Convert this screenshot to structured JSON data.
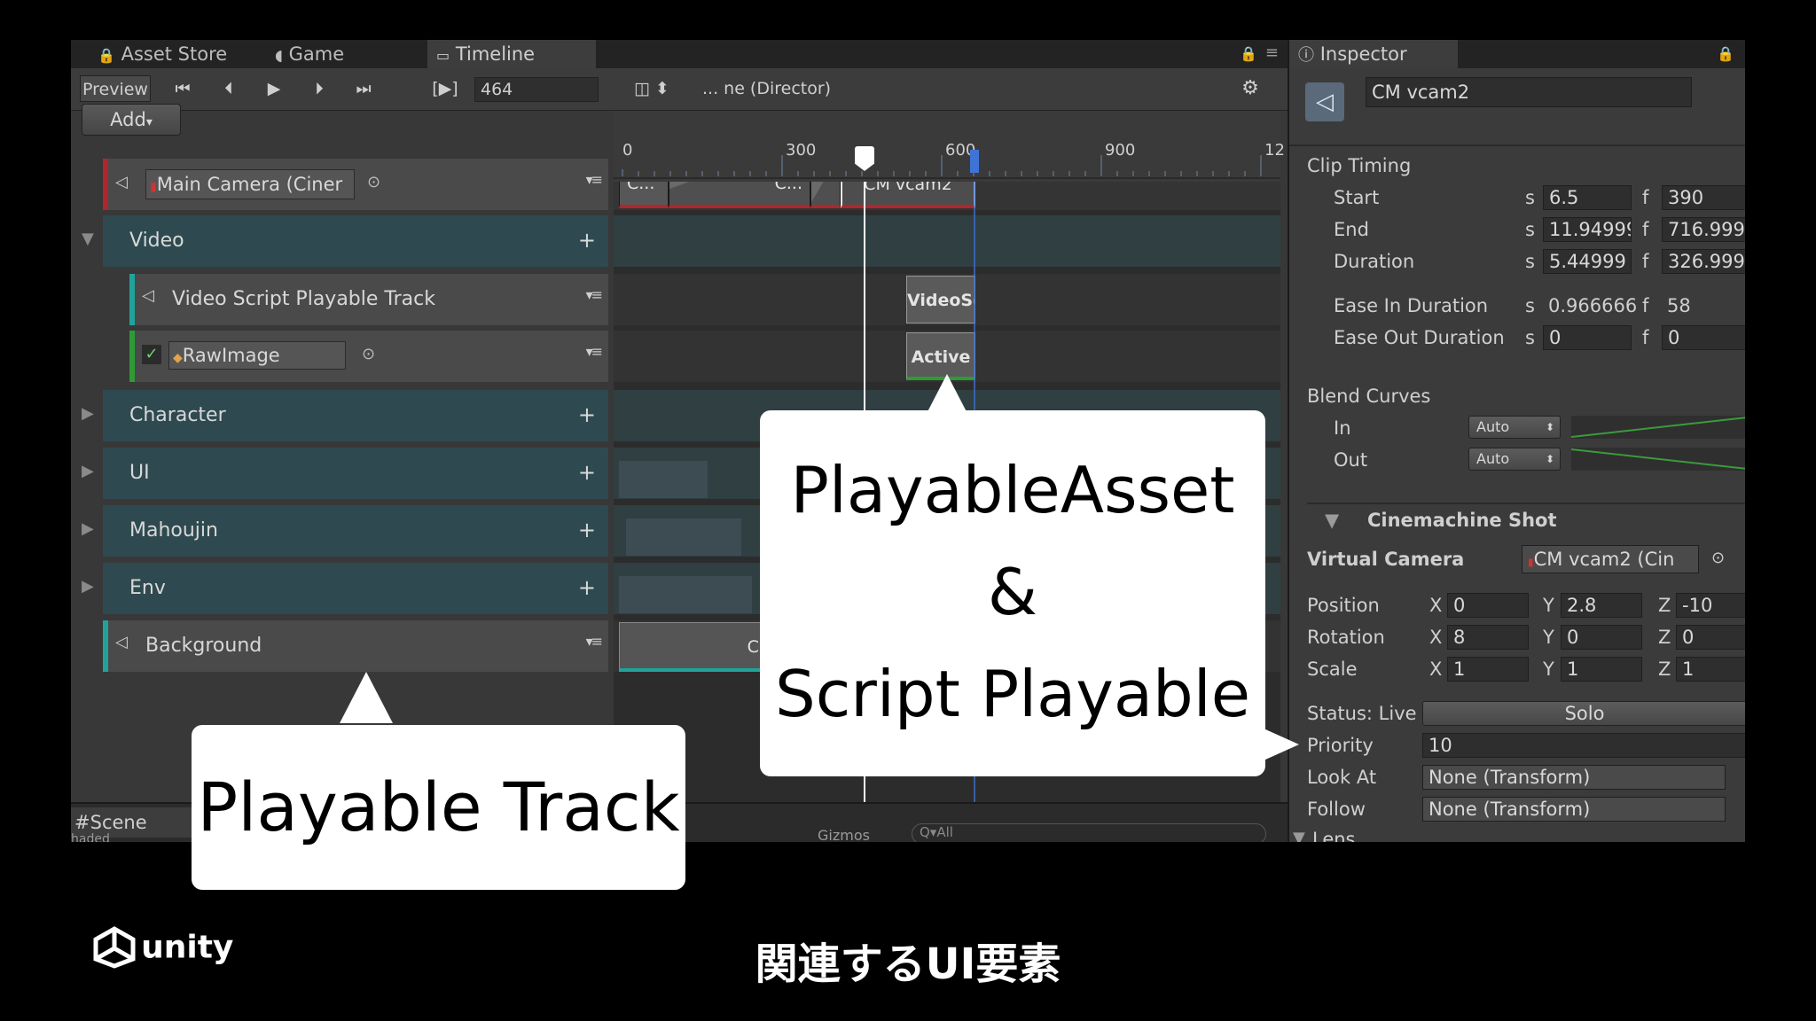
{
  "tabs": {
    "asset_store": "Asset Store",
    "game": "Game",
    "timeline": "Timeline",
    "inspector": "Inspector",
    "scene": "Scene"
  },
  "timeline_toolbar": {
    "preview": "Preview",
    "frame": "464",
    "director": "... ne (Director)",
    "frame_toggle": "[▶]",
    "add": "Add"
  },
  "ruler": {
    "labels": [
      "0",
      "300",
      "600",
      "900",
      "12"
    ]
  },
  "tracks": {
    "main_camera": "Main Camera (Ciner",
    "video": "Video",
    "video_script": "Video Script Playable Track",
    "rawimage": "RawImage",
    "character": "Character",
    "ui": "UI",
    "mahoujin": "Mahoujin",
    "env": "Env",
    "background": "Background"
  },
  "clips": {
    "c1": "C...",
    "c2": "C...",
    "cm_vcam2": "CM vcam2",
    "videosc": "VideoSc...",
    "active": "Active",
    "cont": "Cont"
  },
  "inspector": {
    "object_name": "CM vcam2",
    "clip_timing": "Clip Timing",
    "start_label": "Start",
    "start_s": "6.5",
    "start_f": "390",
    "end_label": "End",
    "end_s": "11.94999",
    "end_f": "716.999",
    "duration_label": "Duration",
    "duration_s": "5.44999",
    "duration_f": "326.999",
    "ease_in_label": "Ease In Duration",
    "ease_in_s": "0.966666",
    "ease_in_f": "58",
    "ease_out_label": "Ease Out Duration",
    "ease_out_s": "0",
    "ease_out_f": "0",
    "s": "s",
    "f": "f",
    "blend_curves": "Blend Curves",
    "in_label": "In",
    "in_value": "Auto",
    "out_label": "Out",
    "out_value": "Auto",
    "cinemachine_shot": "Cinemachine Shot",
    "virtual_camera_label": "Virtual Camera",
    "virtual_camera_value": "CM vcam2 (Cin",
    "position_label": "Position",
    "pos_x": "0",
    "pos_y": "2.8",
    "pos_z": "-10",
    "rotation_label": "Rotation",
    "rot_x": "8",
    "rot_y": "0",
    "rot_z": "0",
    "scale_label": "Scale",
    "scale_x": "1",
    "scale_y": "1",
    "scale_z": "1",
    "x": "X",
    "y": "Y",
    "z": "Z",
    "status_label": "Status: Live",
    "solo": "Solo",
    "priority_label": "Priority",
    "priority_value": "10",
    "look_at_label": "Look At",
    "look_at_value": "None (Transform)",
    "follow_label": "Follow",
    "follow_value": "None (Transform)",
    "lens_label": "Lens"
  },
  "scene_bar": {
    "gizmos": "Gizmos",
    "search": "Q▾All",
    "shaded": "haded"
  },
  "callouts": {
    "playable_asset_line1": "PlayableAsset",
    "playable_asset_line2": "&",
    "playable_asset_line3": "Script Playable",
    "playable_track": "Playable Track"
  },
  "footer": {
    "brand": "unity",
    "caption": "関連するUI要素"
  },
  "colors": {
    "camera_track": "#b0262c",
    "script_track": "#21a39c",
    "activation_track": "#2e9b35",
    "group_track": "#2e4a50",
    "playhead": "#ffffff",
    "end_marker": "#3f73d6"
  }
}
